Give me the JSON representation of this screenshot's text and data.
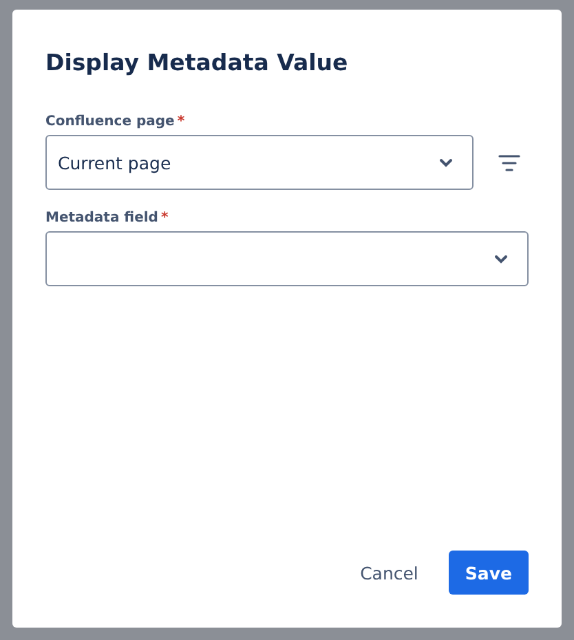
{
  "dialog": {
    "title": "Display Metadata Value"
  },
  "fields": [
    {
      "label": "Confluence page",
      "required_mark": "*",
      "value": "Current page",
      "has_filter": true
    },
    {
      "label": "Metadata field",
      "required_mark": "*",
      "has_filter": false
    }
  ],
  "buttons": [
    {
      "label": "Cancel",
      "kind": "subtle"
    },
    {
      "label": "Save",
      "kind": "primary"
    }
  ]
}
